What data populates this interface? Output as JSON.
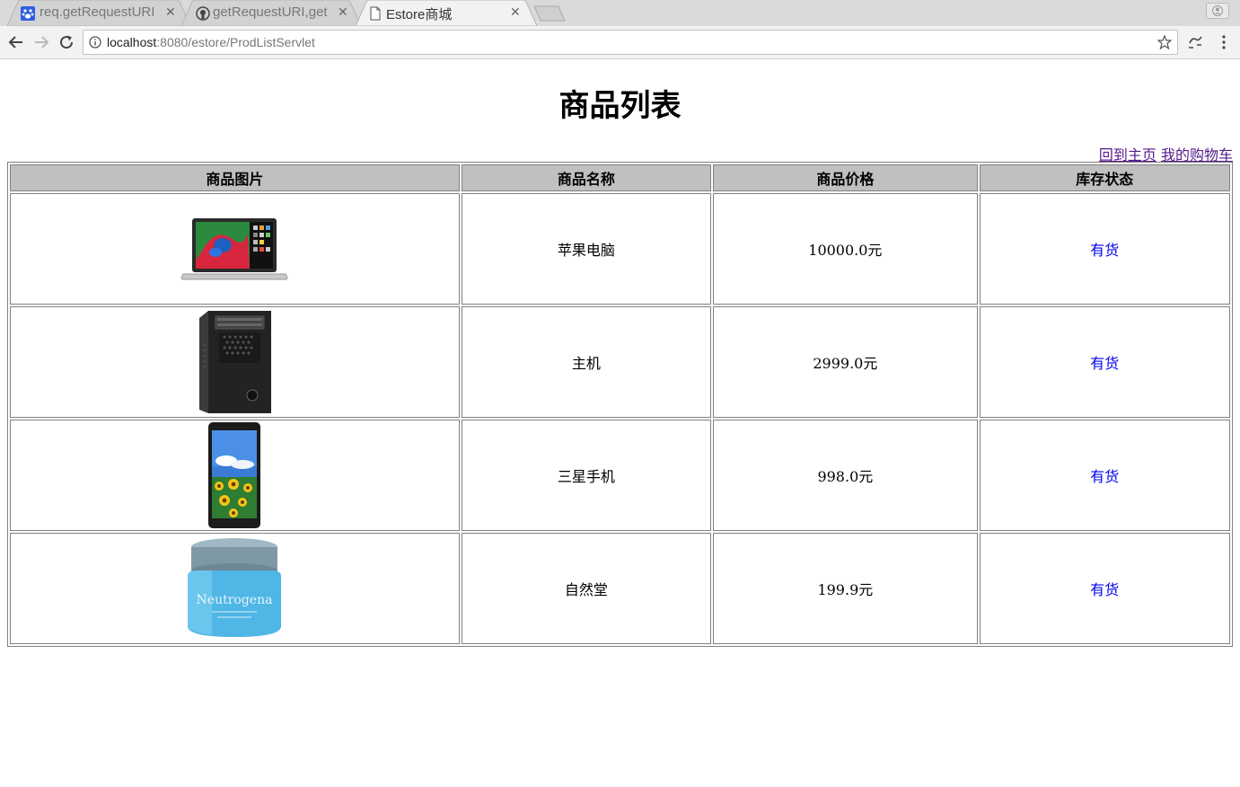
{
  "browser": {
    "tabs": [
      {
        "title": "req.getRequestURI",
        "favicon": "baidu-paw-icon",
        "active": false
      },
      {
        "title": "getRequestURI,get",
        "favicon": "github-icon",
        "active": false
      },
      {
        "title": "Estore商城",
        "favicon": "page-icon",
        "active": true
      }
    ],
    "url_host": "localhost",
    "url_rest": ":8080/estore/ProdListServlet"
  },
  "page": {
    "title": "商品列表",
    "links": {
      "home": "回到主页",
      "cart": "我的购物车"
    },
    "headers": [
      "商品图片",
      "商品名称",
      "商品价格",
      "库存状态"
    ],
    "products": [
      {
        "image": "laptop-image",
        "name": "苹果电脑",
        "price": "10000.0元",
        "stock": "有货"
      },
      {
        "image": "pc-tower-image",
        "name": "主机",
        "price": "2999.0元",
        "stock": "有货"
      },
      {
        "image": "phone-image",
        "name": "三星手机",
        "price": "998.0元",
        "stock": "有货"
      },
      {
        "image": "cream-jar-image",
        "name": "自然堂",
        "price": "199.9元",
        "stock": "有货"
      }
    ],
    "jar_label": "Neutrogena",
    "colors": {
      "header_bg": "#c0c0c0",
      "link_visited": "#551a8b",
      "stock_link": "#0000ee"
    }
  }
}
